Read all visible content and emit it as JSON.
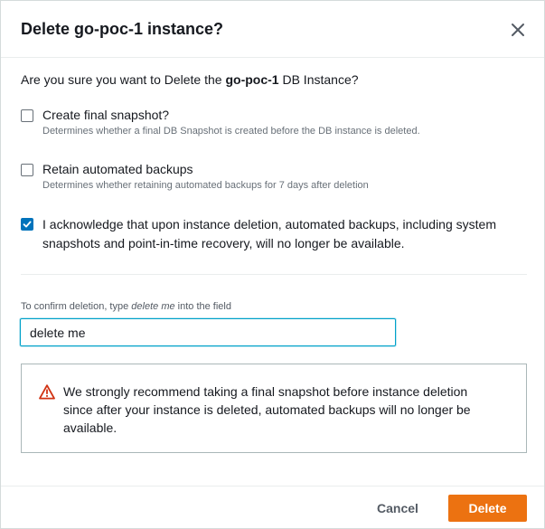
{
  "dialog": {
    "title": "Delete go-poc-1 instance?",
    "prompt_prefix": "Are you sure you want to Delete the ",
    "instance_name": "go-poc-1",
    "prompt_suffix": " DB Instance?"
  },
  "options": {
    "final_snapshot": {
      "label": "Create final snapshot?",
      "description": "Determines whether a final DB Snapshot is created before the DB instance is deleted.",
      "checked": false
    },
    "retain_backups": {
      "label": "Retain automated backups",
      "description": "Determines whether retaining automated backups for 7 days after deletion",
      "checked": false
    },
    "acknowledge": {
      "label": "I acknowledge that upon instance deletion, automated backups, including system snapshots and point-in-time recovery, will no longer be available.",
      "checked": true
    }
  },
  "confirm": {
    "label_prefix": "To confirm deletion, type ",
    "label_phrase": "delete me",
    "label_suffix": " into the field",
    "value": "delete me"
  },
  "warning": {
    "icon": "warning-triangle-icon",
    "text": "We strongly recommend taking a final snapshot before instance deletion since after your instance is deleted, automated backups will no longer be available."
  },
  "footer": {
    "cancel_label": "Cancel",
    "delete_label": "Delete"
  },
  "colors": {
    "primary_button": "#ec7211",
    "checkbox_checked": "#0073bb",
    "input_focus": "#00a1c9",
    "warning": "#d13212"
  }
}
